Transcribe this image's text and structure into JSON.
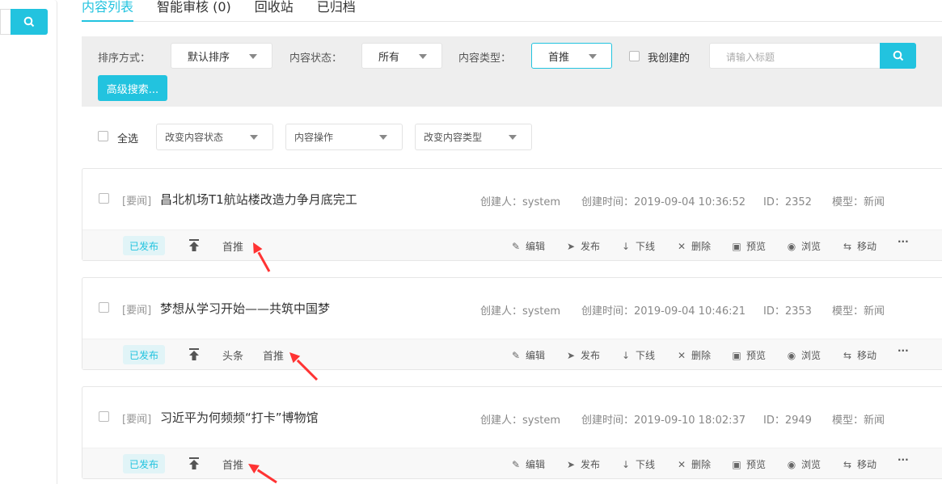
{
  "tabs": [
    "内容列表",
    "智能审核 (0)",
    "回收站",
    "已归档"
  ],
  "filter": {
    "sort_label": "排序方式：",
    "sort_value": "默认排序",
    "status_label": "内容状态：",
    "status_value": "所有",
    "type_label": "内容类型：",
    "type_value": "首推",
    "mine_label": "我创建的",
    "search_placeholder": "请输入标题",
    "advanced_label": "高级搜索..."
  },
  "bulk": {
    "select_all": "全选",
    "change_status": "改变内容状态",
    "content_ops": "内容操作",
    "change_type": "改变内容类型"
  },
  "actions": [
    "编辑",
    "发布",
    "下线",
    "删除",
    "预览",
    "浏览",
    "移动"
  ],
  "items": [
    {
      "tag": "[要闻]",
      "title": "昌北机场T1航站楼改造力争月底完工",
      "creator": "创建人：system",
      "created": "创建时间：2019-09-04 10:36:52",
      "id": "ID：2352",
      "model": "模型：新闻",
      "status": "已发布",
      "recs": [
        "首推"
      ]
    },
    {
      "tag": "[要闻]",
      "title": "梦想从学习开始——共筑中国梦",
      "creator": "创建人：system",
      "created": "创建时间：2019-09-04 10:46:21",
      "id": "ID：2353",
      "model": "模型：新闻",
      "status": "已发布",
      "recs": [
        "头条",
        "首推"
      ]
    },
    {
      "tag": "[要闻]",
      "title": "习近平为何频频“打卡”博物馆",
      "creator": "创建人：system",
      "created": "创建时间：2019-09-10 18:02:37",
      "id": "ID：2949",
      "model": "模型：新闻",
      "status": "已发布",
      "recs": [
        "首推"
      ]
    }
  ]
}
